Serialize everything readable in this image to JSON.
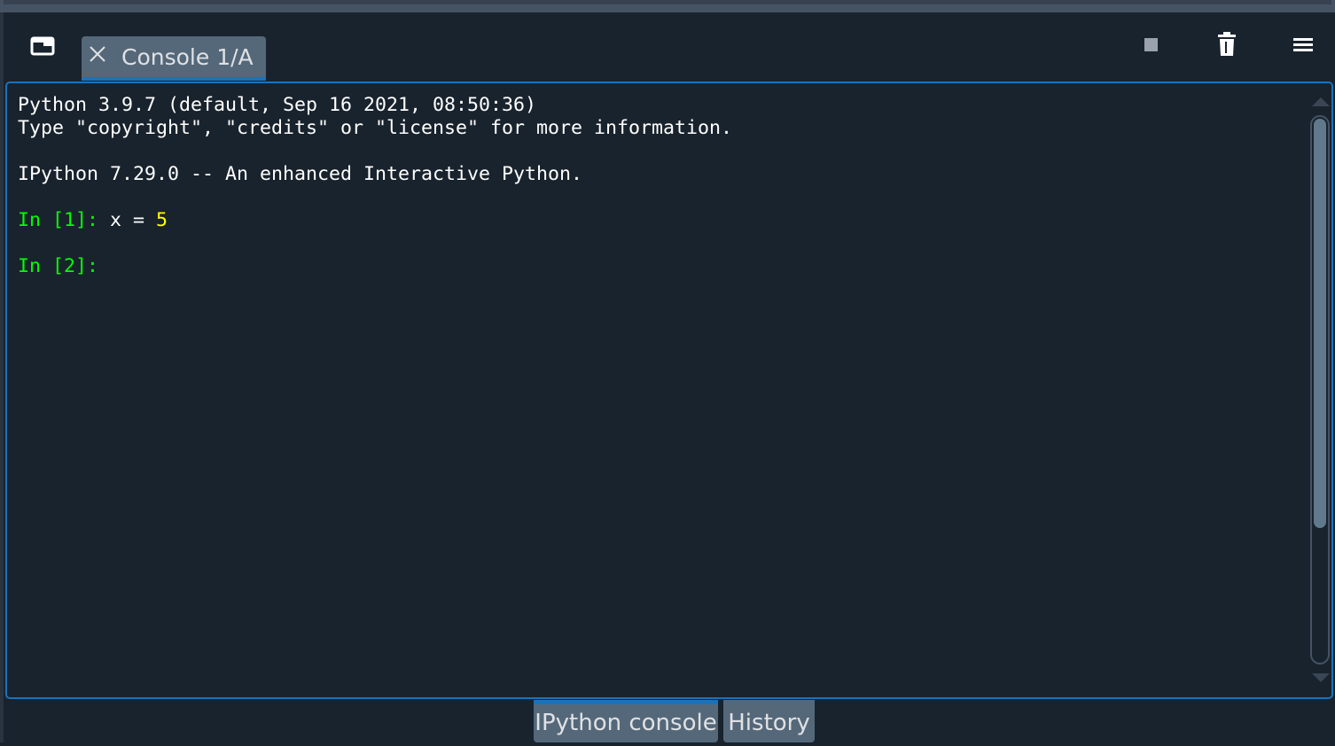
{
  "console_tab": {
    "label": "Console 1/A",
    "close_icon": "close-icon"
  },
  "toolbar": {
    "undock_icon": "undock-window-icon",
    "interrupt_icon": "stop-square-icon",
    "remove_variables_icon": "trash-icon",
    "options_icon": "hamburger-menu-icon"
  },
  "console": {
    "banner_line1": "Python 3.9.7 (default, Sep 16 2021, 08:50:36)",
    "banner_line2": "Type \"copyright\", \"credits\" or \"license\" for more information.",
    "banner_line3": "IPython 7.29.0 -- An enhanced Interactive Python.",
    "in1_prompt": "In [1]:",
    "in1_code_pre": " x = ",
    "in1_code_num": "5",
    "in2_prompt": "In [2]:"
  },
  "bottom_tabs": [
    {
      "label": "IPython console",
      "active": true
    },
    {
      "label": "History",
      "active": false
    }
  ],
  "colors": {
    "background": "#19232d",
    "accent": "#1a72bb",
    "prompt": "#00ff00",
    "number": "#ffff00",
    "tab": "#54687a"
  }
}
